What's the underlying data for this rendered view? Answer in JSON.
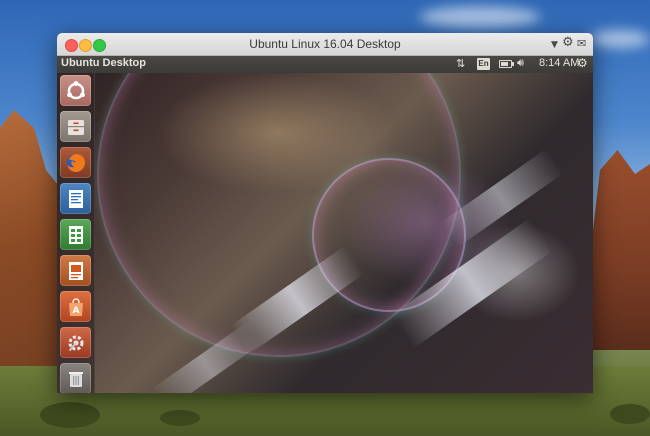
{
  "window": {
    "title": "Ubuntu Linux 16.04 Desktop"
  },
  "panel": {
    "title": "Ubuntu Desktop",
    "keyboard_layout": "En",
    "time": "8:14 AM"
  },
  "launcher": {
    "items": [
      {
        "name": "dash-home",
        "icon": "ubuntu-logo-icon",
        "color": "#c0837a"
      },
      {
        "name": "files",
        "icon": "file-cabinet-icon",
        "color": "#9a8f84"
      },
      {
        "name": "firefox",
        "icon": "firefox-icon",
        "color": "#e66000"
      },
      {
        "name": "libreoffice-writer",
        "icon": "writer-document-icon",
        "color": "#2a72b9"
      },
      {
        "name": "libreoffice-calc",
        "icon": "calc-spreadsheet-icon",
        "color": "#3a9b3a"
      },
      {
        "name": "libreoffice-impress",
        "icon": "impress-presentation-icon",
        "color": "#d4571d"
      },
      {
        "name": "ubuntu-software",
        "icon": "software-bag-icon",
        "color": "#e45c2a"
      },
      {
        "name": "system-settings",
        "icon": "settings-tools-icon",
        "color": "#c94b2c"
      },
      {
        "name": "trash",
        "icon": "trash-icon",
        "color": "#7f7f7f"
      }
    ]
  }
}
